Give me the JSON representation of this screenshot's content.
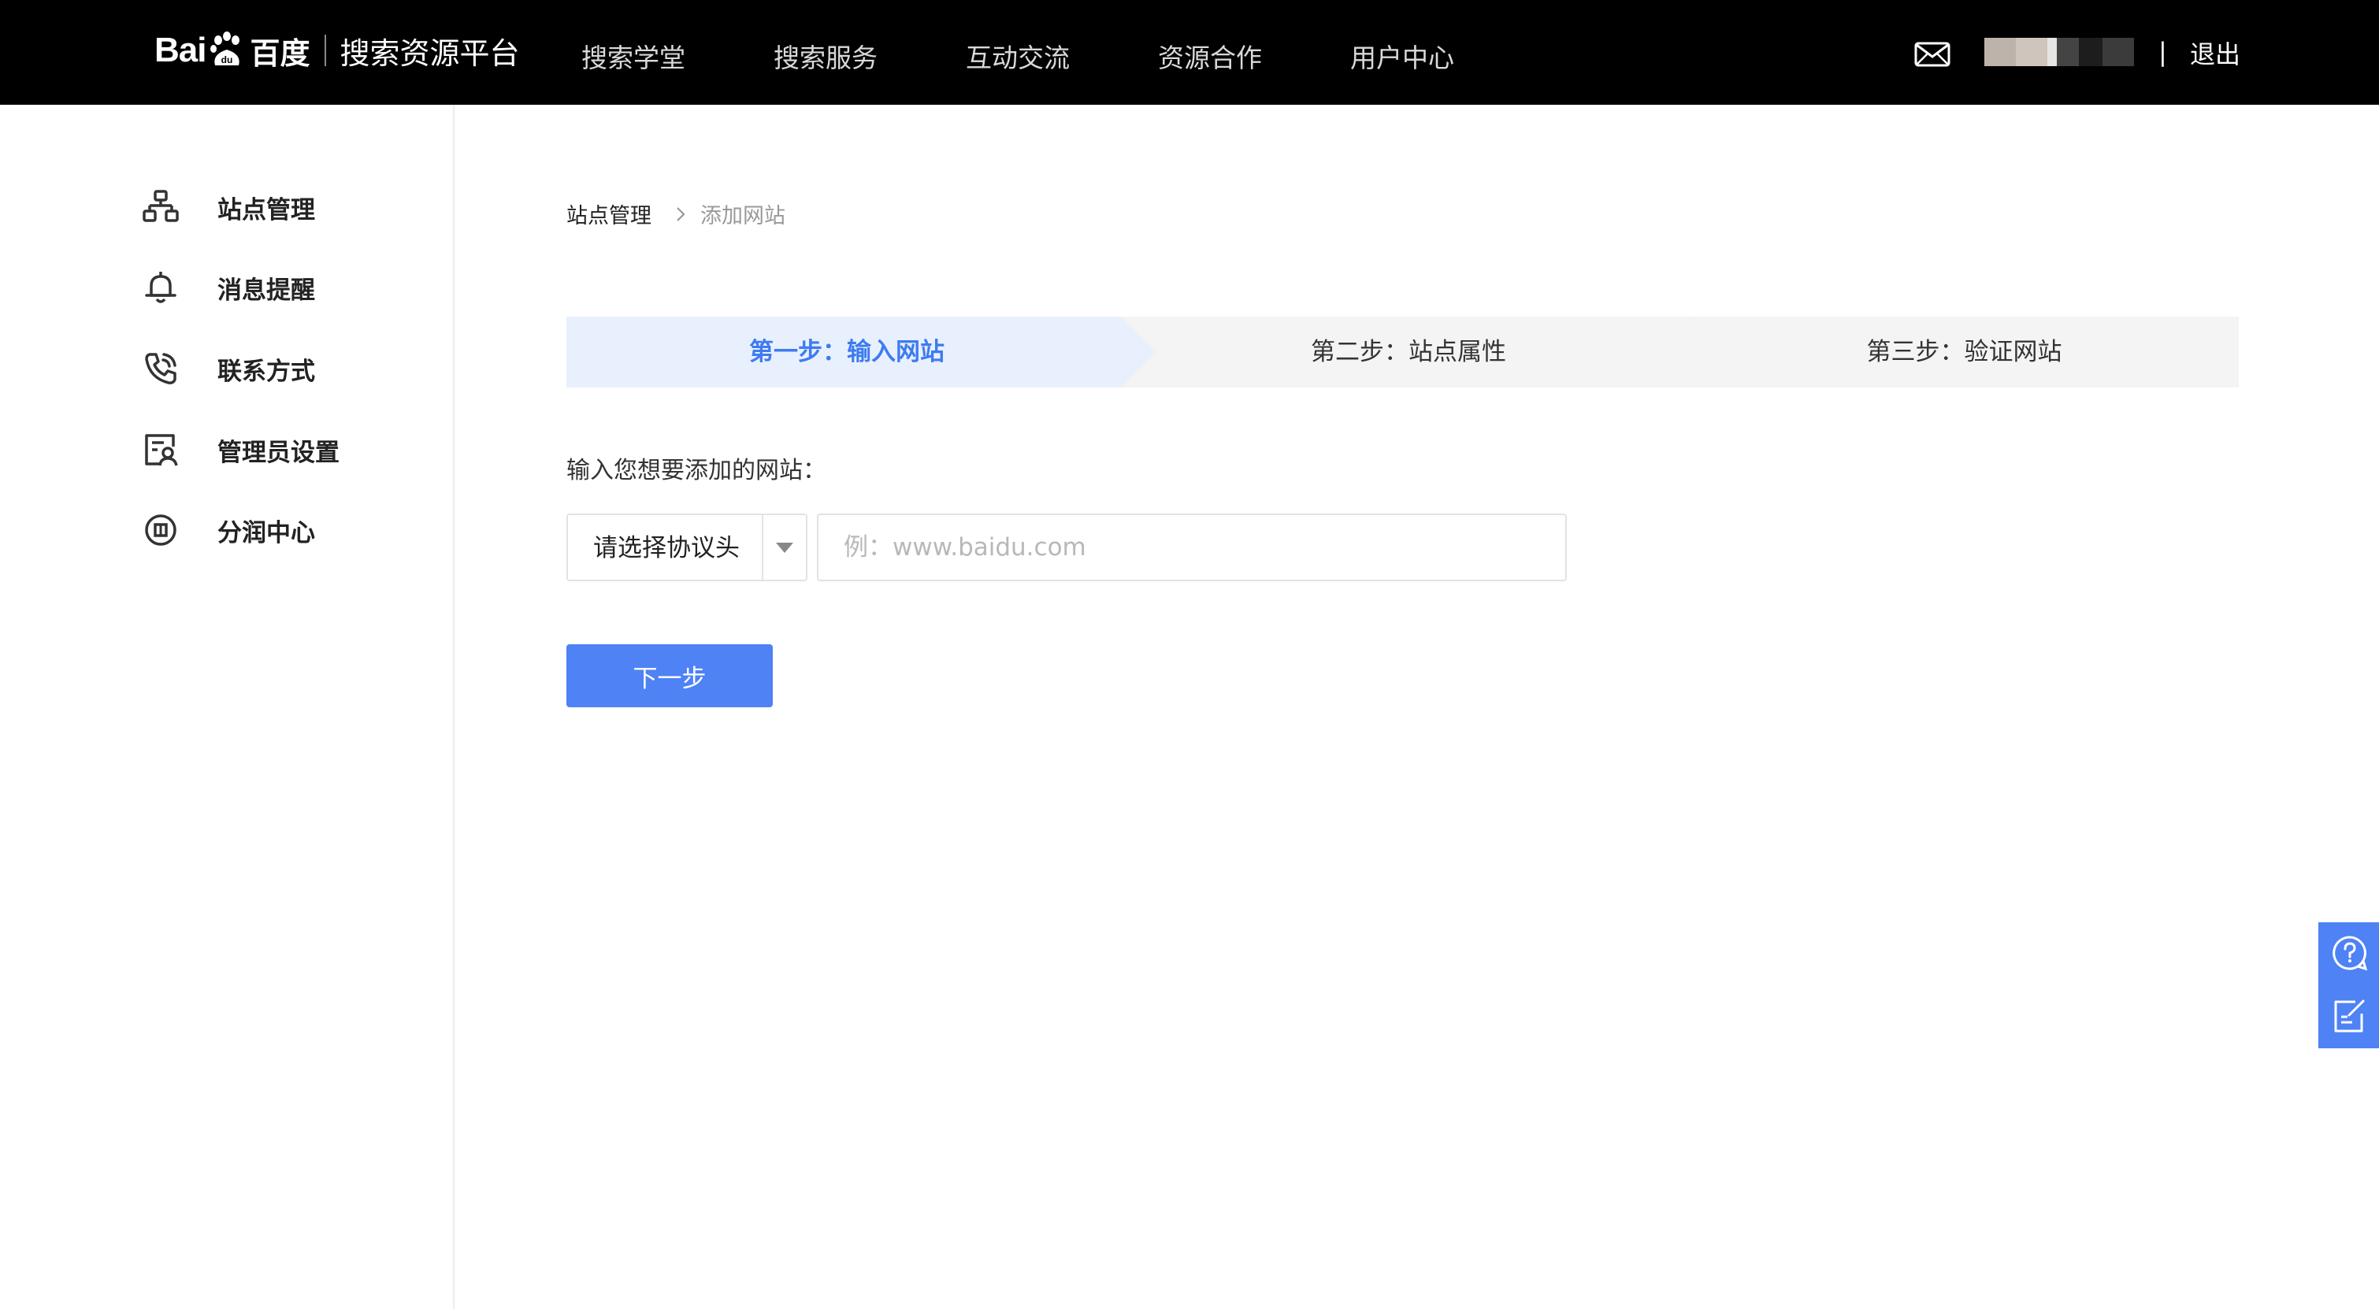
{
  "header": {
    "logo_text": "Bai",
    "logo_text_cn": "百度",
    "platform_title": "搜索资源平台",
    "nav": [
      "搜索学堂",
      "搜索服务",
      "互动交流",
      "资源合作",
      "用户中心"
    ],
    "mail_icon": "mail-icon",
    "pipe": "|",
    "logout_label": "退出"
  },
  "sidebar": {
    "items": [
      {
        "label": "站点管理",
        "icon": "sitemap-icon"
      },
      {
        "label": "消息提醒",
        "icon": "bell-icon"
      },
      {
        "label": "联系方式",
        "icon": "phone-icon"
      },
      {
        "label": "管理员设置",
        "icon": "admin-icon"
      },
      {
        "label": "分润中心",
        "icon": "revenue-icon"
      }
    ]
  },
  "breadcrumb": {
    "root": "站点管理",
    "current": "添加网站"
  },
  "steps": [
    {
      "label": "第一步：输入网站",
      "active": true
    },
    {
      "label": "第二步：站点属性",
      "active": false
    },
    {
      "label": "第三步：验证网站",
      "active": false
    }
  ],
  "form": {
    "prompt": "输入您想要添加的网站：",
    "protocol_value": "请选择协议头",
    "url_placeholder": "例：www.baidu.com",
    "url_value": "",
    "next_label": "下一步"
  },
  "float_panel": {
    "icons": [
      "help-icon",
      "feedback-icon"
    ]
  },
  "colors": {
    "header_bg": "#000000",
    "accent": "#4e82f5",
    "active_step_text": "#3e7bf0",
    "active_step_bg": "#e8f0fd",
    "inactive_step_bg": "#f4f4f4"
  }
}
